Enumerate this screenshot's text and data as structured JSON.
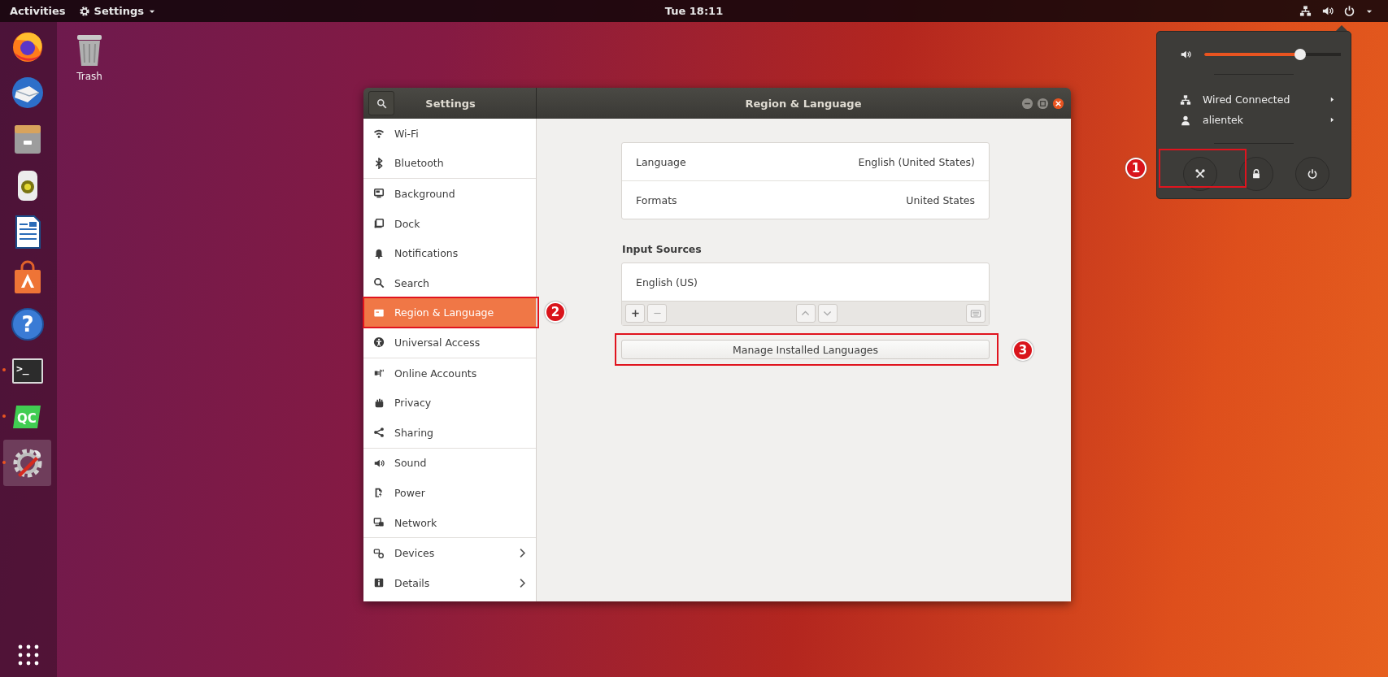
{
  "top_bar": {
    "activities": "Activities",
    "app_menu": "Settings",
    "clock": "Tue 18:11"
  },
  "dock": {
    "items": [
      {
        "kind": "browser",
        "running": false,
        "selected": false
      },
      {
        "kind": "mail",
        "running": false,
        "selected": false
      },
      {
        "kind": "files",
        "running": false,
        "selected": false
      },
      {
        "kind": "music",
        "running": false,
        "selected": false
      },
      {
        "kind": "writer",
        "running": false,
        "selected": false
      },
      {
        "kind": "software",
        "running": false,
        "selected": false
      },
      {
        "kind": "help",
        "label": "?",
        "running": false,
        "selected": false
      },
      {
        "kind": "terminal",
        "label": ">_",
        "running": true,
        "selected": false
      },
      {
        "kind": "qc",
        "label": "QC",
        "running": true,
        "selected": false
      },
      {
        "kind": "settings",
        "running": true,
        "selected": true
      }
    ]
  },
  "desktop_icons": [
    {
      "label": "Trash"
    }
  ],
  "settings_window": {
    "sidebar_title": "Settings",
    "title": "Region & Language",
    "sidebar_groups": [
      {
        "items": [
          {
            "label": "Wi-Fi",
            "selected": false,
            "arrow": false
          },
          {
            "label": "Bluetooth",
            "selected": false,
            "arrow": false
          }
        ]
      },
      {
        "items": [
          {
            "label": "Background",
            "selected": false,
            "arrow": false
          },
          {
            "label": "Dock",
            "selected": false,
            "arrow": false
          },
          {
            "label": "Notifications",
            "selected": false,
            "arrow": false
          },
          {
            "label": "Search",
            "selected": false,
            "arrow": false
          },
          {
            "label": "Region & Language",
            "selected": true,
            "arrow": false
          },
          {
            "label": "Universal Access",
            "selected": false,
            "arrow": false
          }
        ]
      },
      {
        "items": [
          {
            "label": "Online Accounts",
            "selected": false,
            "arrow": false
          },
          {
            "label": "Privacy",
            "selected": false,
            "arrow": false
          },
          {
            "label": "Sharing",
            "selected": false,
            "arrow": false
          }
        ]
      },
      {
        "items": [
          {
            "label": "Sound",
            "selected": false,
            "arrow": false
          },
          {
            "label": "Power",
            "selected": false,
            "arrow": false
          },
          {
            "label": "Network",
            "selected": false,
            "arrow": false
          }
        ]
      },
      {
        "items": [
          {
            "label": "Devices",
            "selected": false,
            "arrow": true
          },
          {
            "label": "Details",
            "selected": false,
            "arrow": true
          }
        ]
      }
    ],
    "language_rows": [
      {
        "label": "Language",
        "value": "English (United States)"
      },
      {
        "label": "Formats",
        "value": "United States"
      }
    ],
    "input_sources": {
      "heading": "Input Sources",
      "items": [
        "English (US)"
      ]
    },
    "manage_button": "Manage Installed Languages"
  },
  "system_menu": {
    "volume": {
      "level": 0.7
    },
    "items": [
      {
        "kind": "network",
        "label": "Wired Connected"
      },
      {
        "kind": "user",
        "label": "alientek"
      }
    ]
  },
  "annotations": [
    {
      "number": "1"
    },
    {
      "number": "2"
    },
    {
      "number": "3"
    }
  ]
}
